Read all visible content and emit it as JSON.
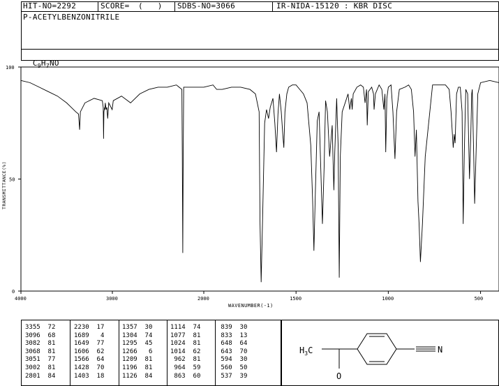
{
  "header": {
    "hit_no": "HIT-NO=2292",
    "score_label": "SCORE=",
    "score_value": "(   )",
    "sdbs_no": "SDBS-NO=3066",
    "ir_info": "IR-NIDA-15120 : KBR DISC"
  },
  "compound": {
    "name": "P-ACETYLBENZONITRILE",
    "formula_parts": [
      "C",
      "9",
      "H",
      "7",
      "NO"
    ]
  },
  "chart_data": {
    "type": "line",
    "title": "",
    "xlabel": "WAVENUMBER(-1)",
    "ylabel": "TRANSMITTANCE(%)",
    "xlim": [
      4000,
      400
    ],
    "ylim": [
      0,
      100
    ],
    "x_ticks": [
      4000,
      3000,
      2000,
      1500,
      1000,
      500
    ],
    "y_ticks": [
      0,
      50,
      100
    ],
    "grid": false,
    "series": [
      {
        "x": [
          4000,
          3900,
          3800,
          3700,
          3600,
          3500,
          3450,
          3400,
          3370,
          3365,
          3358,
          3350,
          3300,
          3200,
          3110,
          3100,
          3096,
          3092,
          3085,
          3082,
          3078,
          3068,
          3060,
          3051,
          3040,
          3002,
          2990,
          2900,
          2801,
          2700,
          2600,
          2500,
          2400,
          2300,
          2240,
          2235,
          2230,
          2225,
          2220,
          2100,
          2000,
          1950,
          1930,
          1900,
          1850,
          1800,
          1750,
          1720,
          1700,
          1695,
          1689,
          1682,
          1670,
          1660,
          1649,
          1640,
          1625,
          1615,
          1606,
          1598,
          1590,
          1580,
          1572,
          1566,
          1560,
          1550,
          1540,
          1520,
          1500,
          1480,
          1460,
          1440,
          1420,
          1410,
          1403,
          1396,
          1385,
          1375,
          1366,
          1357,
          1348,
          1340,
          1330,
          1318,
          1304,
          1300,
          1295,
          1290,
          1280,
          1272,
          1266,
          1260,
          1250,
          1230,
          1218,
          1209,
          1200,
          1196,
          1190,
          1170,
          1150,
          1135,
          1126,
          1118,
          1114,
          1108,
          1090,
          1080,
          1077,
          1070,
          1050,
          1035,
          1024,
          1018,
          1014,
          1008,
          1000,
          985,
          975,
          964,
          955,
          940,
          910,
          890,
          875,
          863,
          855,
          848,
          839,
          833,
          826,
          815,
          800,
          760,
          720,
          690,
          670,
          660,
          648,
          643,
          638,
          630,
          620,
          610,
          600,
          594,
          588,
          580,
          570,
          560,
          553,
          548,
          545,
          537,
          532,
          525,
          515,
          500,
          450,
          400
        ],
        "y": [
          94,
          93,
          91,
          89,
          87,
          84,
          82,
          80,
          79,
          76,
          72,
          80,
          84,
          86,
          85,
          82,
          68,
          80,
          82,
          81,
          84,
          81,
          82,
          77,
          84,
          81,
          85,
          87,
          84,
          88,
          90,
          91,
          91,
          92,
          90,
          60,
          17,
          60,
          91,
          91,
          91,
          92,
          90,
          90,
          91,
          91,
          90,
          88,
          80,
          30,
          4,
          30,
          75,
          81,
          77,
          82,
          86,
          75,
          62,
          79,
          88,
          80,
          70,
          64,
          80,
          88,
          91,
          92,
          92,
          90,
          88,
          84,
          65,
          40,
          18,
          42,
          76,
          80,
          55,
          30,
          55,
          85,
          80,
          60,
          74,
          60,
          45,
          62,
          86,
          65,
          6,
          60,
          80,
          85,
          88,
          81,
          86,
          81,
          88,
          91,
          92,
          91,
          84,
          90,
          74,
          89,
          91,
          88,
          81,
          88,
          92,
          90,
          81,
          88,
          62,
          86,
          91,
          92,
          80,
          59,
          80,
          90,
          91,
          92,
          90,
          80,
          60,
          72,
          40,
          30,
          13,
          30,
          60,
          92,
          92,
          92,
          90,
          80,
          64,
          70,
          66,
          88,
          91,
          91,
          80,
          30,
          62,
          90,
          88,
          50,
          70,
          88,
          90,
          60,
          39,
          60,
          88,
          93,
          94,
          93
        ]
      }
    ]
  },
  "peaks": {
    "columns": [
      [
        [
          "3355",
          "72"
        ],
        [
          "3096",
          "68"
        ],
        [
          "3082",
          "81"
        ],
        [
          "3068",
          "81"
        ],
        [
          "3051",
          "77"
        ],
        [
          "3002",
          "81"
        ],
        [
          "2801",
          "84"
        ]
      ],
      [
        [
          "2230",
          "17"
        ],
        [
          "1689",
          "4"
        ],
        [
          "1649",
          "77"
        ],
        [
          "1606",
          "62"
        ],
        [
          "1566",
          "64"
        ],
        [
          "1428",
          "70"
        ],
        [
          "1403",
          "18"
        ]
      ],
      [
        [
          "1357",
          "30"
        ],
        [
          "1304",
          "74"
        ],
        [
          "1295",
          "45"
        ],
        [
          "1266",
          "6"
        ],
        [
          "1209",
          "81"
        ],
        [
          "1196",
          "81"
        ],
        [
          "1126",
          "84"
        ]
      ],
      [
        [
          "1114",
          "74"
        ],
        [
          "1077",
          "81"
        ],
        [
          "1024",
          "81"
        ],
        [
          "1014",
          "62"
        ],
        [
          "962",
          "81"
        ],
        [
          "964",
          "59"
        ],
        [
          "863",
          "60"
        ]
      ],
      [
        [
          "839",
          "30"
        ],
        [
          "833",
          "13"
        ],
        [
          "648",
          "64"
        ],
        [
          "643",
          "70"
        ],
        [
          "594",
          "30"
        ],
        [
          "560",
          "50"
        ],
        [
          "537",
          "39"
        ]
      ]
    ]
  },
  "structure": {
    "methyl_label": "H3C",
    "oxygen_label": "O",
    "nitrogen_label": "N"
  }
}
